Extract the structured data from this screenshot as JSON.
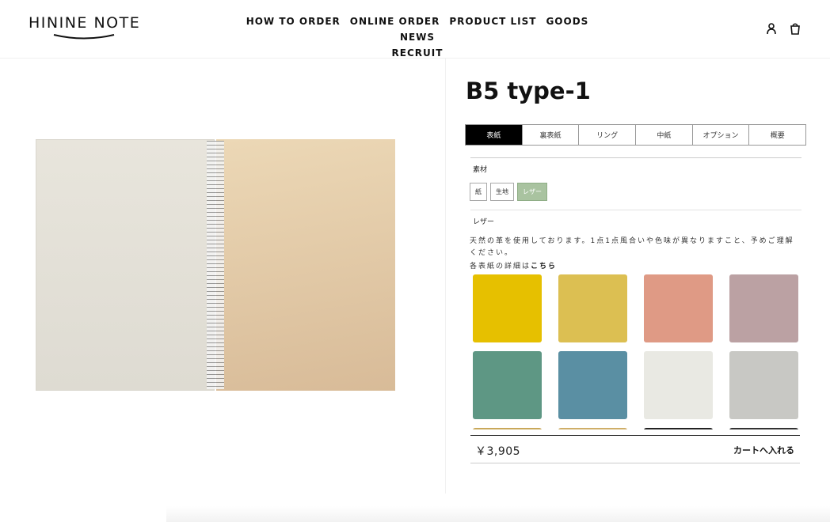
{
  "header": {
    "logo_text": "HININE NOTE",
    "nav": [
      "HOW TO ORDER",
      "ONLINE ORDER",
      "PRODUCT LIST",
      "GOODS",
      "NEWS",
      "RECRUIT"
    ],
    "icons": [
      "account-icon",
      "cart-icon"
    ]
  },
  "product": {
    "title": "B5 type-1",
    "tabs": [
      "表紙",
      "裏表紙",
      "リング",
      "中紙",
      "オプション",
      "概要"
    ],
    "active_tab": "表紙",
    "material_label": "素材",
    "materials": [
      "紙",
      "生地",
      "レザー"
    ],
    "selected_material": "レザー",
    "selected_label": "レザー",
    "description": "天然の革を使用しております。1点1点風合いや色味が異なりますこと、予めご理解ください。",
    "detail_prefix": "各表紙の詳細は",
    "detail_link": "こちら",
    "swatches": [
      {
        "name": "yellow",
        "color": "#e6c000"
      },
      {
        "name": "mustard",
        "color": "#dcbf52"
      },
      {
        "name": "salmon",
        "color": "#df9a85"
      },
      {
        "name": "mauve",
        "color": "#bba1a3"
      },
      {
        "name": "green",
        "color": "#5e9784"
      },
      {
        "name": "blue",
        "color": "#5a8fa3"
      },
      {
        "name": "white",
        "color": "#e9e9e3"
      },
      {
        "name": "gray",
        "color": "#c8c8c4"
      },
      {
        "name": "gold",
        "color": "#c9a85a"
      },
      {
        "name": "tan",
        "color": "#cfae68"
      },
      {
        "name": "black",
        "color": "#222222"
      },
      {
        "name": "dark",
        "color": "#333333"
      }
    ],
    "price": "￥3,905",
    "cart_label": "カートへ入れる"
  }
}
